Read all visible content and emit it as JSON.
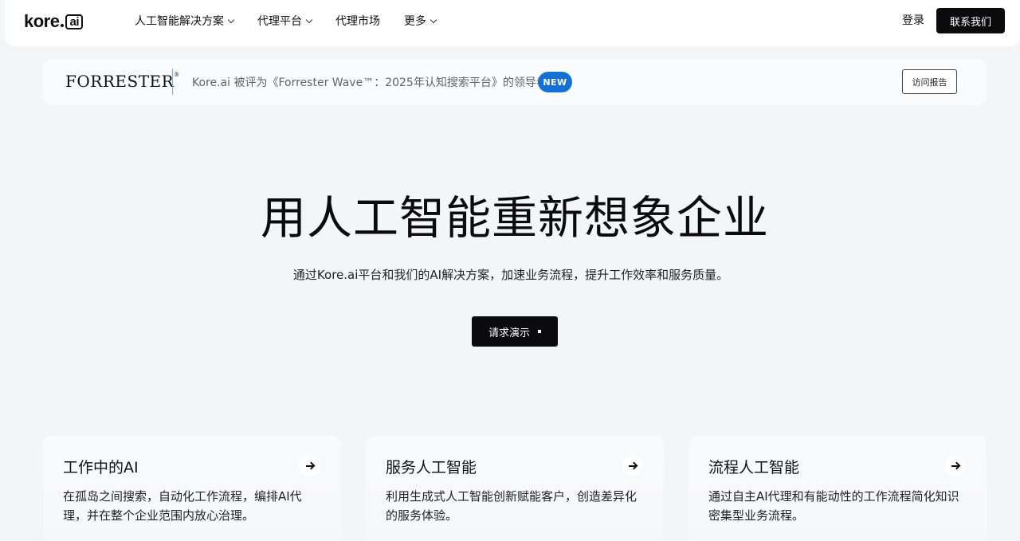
{
  "nav": {
    "logo_text": "kore",
    "logo_ai": "ai",
    "items": [
      {
        "label": "人工智能解决方案"
      },
      {
        "label": "代理平台"
      },
      {
        "label": "代理市场"
      },
      {
        "label": "更多"
      }
    ],
    "login": "登录",
    "contact": "联系我们"
  },
  "banner": {
    "brand": "FORRESTER",
    "brand_mark": "®",
    "text": "Kore.ai 被评为《Forrester Wave™：2025年认知搜索平台》的领导者",
    "badge": "NEW",
    "button": "访问报告"
  },
  "hero": {
    "title": "用人工智能重新想象企业",
    "subtitle": "通过Kore.ai平台和我们的AI解决方案，加速业务流程，提升工作效率和服务质量。",
    "cta": "请求演示"
  },
  "cards": [
    {
      "title": "工作中的AI",
      "desc": "在孤岛之间搜索，自动化工作流程，编排AI代理，并在整个企业范围内放心治理。"
    },
    {
      "title": "服务人工智能",
      "desc": "利用生成式人工智能创新赋能客户，创造差异化的服务体验。"
    },
    {
      "title": "流程人工智能",
      "desc": "通过自主AI代理和有能动性的工作流程简化知识密集型业务流程。"
    }
  ]
}
